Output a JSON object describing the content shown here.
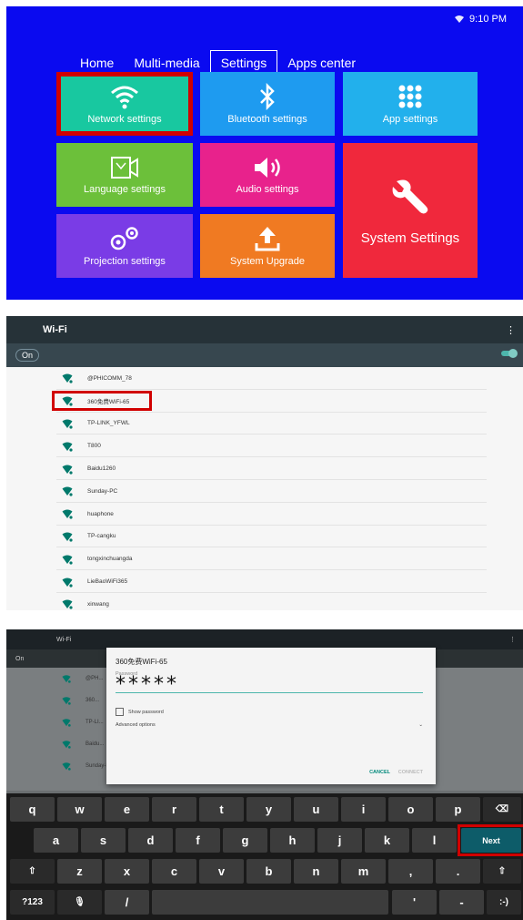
{
  "launcher": {
    "status_time": "9:10 PM",
    "nav_tabs": [
      "Home",
      "Multi-media",
      "Settings",
      "Apps center"
    ],
    "active_tab": "Settings",
    "tiles": {
      "network": "Network settings",
      "bluetooth": "Bluetooth settings",
      "app": "App settings",
      "language": "Language settings",
      "audio": "Audio settings",
      "system": "System Settings",
      "projection": "Projection settings",
      "upgrade": "System Upgrade"
    },
    "colors": {
      "background": "#0a0af0",
      "network": "#18c8a0",
      "bluetooth": "#1e9bf0",
      "app": "#22b0ec",
      "language": "#6cc03a",
      "audio": "#e8228c",
      "system": "#f0283c",
      "projection": "#7a3ce6",
      "upgrade": "#f07a22",
      "highlight": "#d10000"
    }
  },
  "wifi": {
    "title": "Wi-Fi",
    "more": "⋮",
    "toggle_label": "On",
    "networks": [
      "@PHICOMM_78",
      "360免费WiFi-65",
      "TP-LINK_YFWL",
      "T800",
      "Baidu1260",
      "Sunday-PC",
      "huaphone",
      "TP-cangku",
      "tongxinchuangda",
      "LieBaoWiFi365",
      "xinwang"
    ],
    "selected_network": "360免费WiFi-65"
  },
  "dialog": {
    "bg_title": "Wi-Fi",
    "bg_on": "On",
    "bg_networks": [
      "@PH...",
      "360...",
      "TP-LI...",
      "Baidu...",
      "Sunday-PC"
    ],
    "title": "360免费WiFi-65",
    "password_label": "Password",
    "password_value": "*****",
    "show_password": "Show password",
    "advanced": "Advanced options",
    "cancel": "CANCEL",
    "connect": "CONNECT"
  },
  "keyboard": {
    "row1": [
      "q",
      "w",
      "e",
      "r",
      "t",
      "y",
      "u",
      "i",
      "o",
      "p"
    ],
    "row2": [
      "a",
      "s",
      "d",
      "f",
      "g",
      "h",
      "j",
      "k",
      "l"
    ],
    "row3": [
      "z",
      "x",
      "c",
      "v",
      "b",
      "n",
      "m",
      ",",
      "."
    ],
    "backspace": "⌫",
    "next": "Next",
    "shift": "⇧",
    "symbols": "?123",
    "mic": "🎙",
    "slash": "/",
    "quote": "'",
    "dash": "-",
    "emoji": ":-)"
  }
}
